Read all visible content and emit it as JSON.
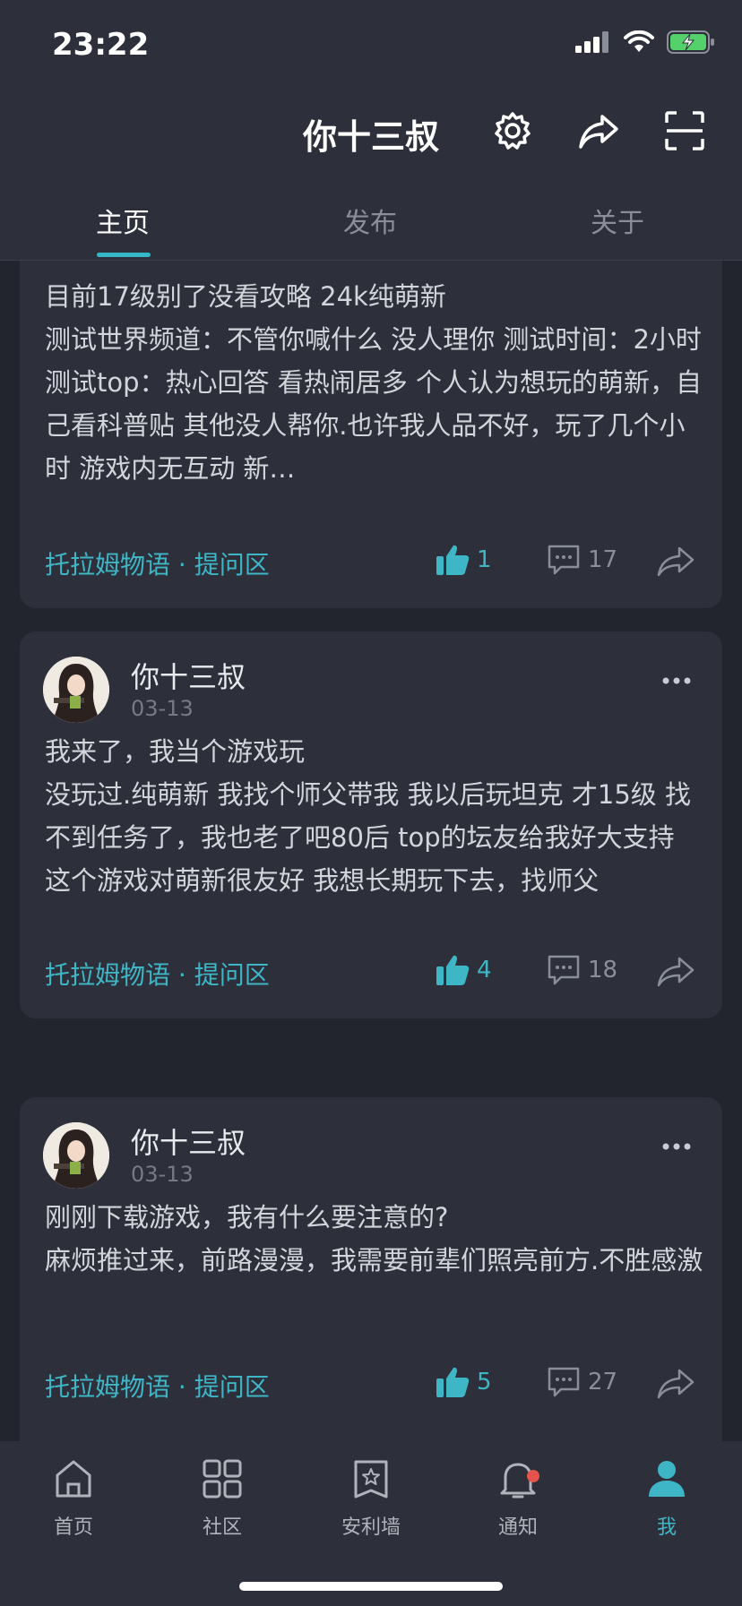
{
  "status_bar": {
    "time": "23:22"
  },
  "header": {
    "title": "你十三叔"
  },
  "tabs": [
    {
      "label": "主页",
      "active": true
    },
    {
      "label": "发布",
      "active": false
    },
    {
      "label": "关于",
      "active": false
    }
  ],
  "posts": [
    {
      "lines": [
        "目前17级别了没看攻略 24k纯萌新",
        "测试世界频道：不管你喊什么 没人理你 测试时间：2小时 测试top：热心回答  看热闹居多 个人认为想玩的萌新，自己看科普贴 其他没人帮你.也许我人品不好，玩了几个小时 游戏内无互动 新…"
      ],
      "topic": "托拉姆物语 · 提问区",
      "likes": "1",
      "comments": "17"
    },
    {
      "author": "你十三叔",
      "date": "03-13",
      "lines": [
        "我来了，我当个游戏玩",
        "没玩过.纯萌新 我找个师父带我 我以后玩坦克 才15级 找不到任务了，我也老了吧80后 top的坛友给我好大支持 这个游戏对萌新很友好 我想长期玩下去，找师父"
      ],
      "topic": "托拉姆物语 · 提问区",
      "likes": "4",
      "comments": "18"
    },
    {
      "author": "你十三叔",
      "date": "03-13",
      "lines": [
        "刚刚下载游戏，我有什么要注意的?",
        "麻烦推过来，前路漫漫，我需要前辈们照亮前方.不胜感激"
      ],
      "topic": "托拉姆物语 · 提问区",
      "likes": "5",
      "comments": "27"
    }
  ],
  "bottom_nav": [
    {
      "label": "首页",
      "icon": "home-icon",
      "active": false
    },
    {
      "label": "社区",
      "icon": "grid-icon",
      "active": false
    },
    {
      "label": "安利墙",
      "icon": "star-badge-icon",
      "active": false
    },
    {
      "label": "通知",
      "icon": "bell-icon",
      "active": false,
      "badge": true
    },
    {
      "label": "我",
      "icon": "user-icon",
      "active": true
    }
  ],
  "colors": {
    "accent": "#3fb6c6",
    "background": "#22252e",
    "card": "#2d303b",
    "badge": "#e5534b"
  }
}
